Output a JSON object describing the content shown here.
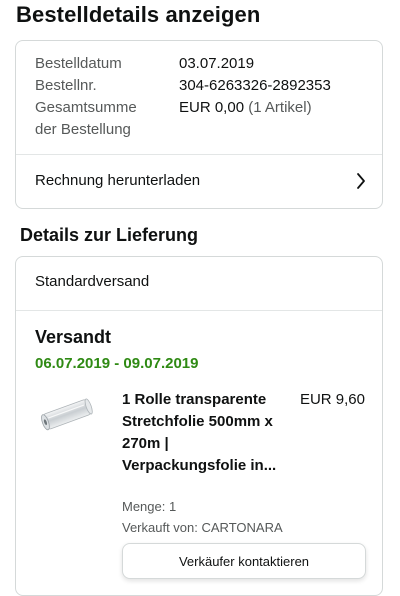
{
  "page": {
    "title": "Bestelldetails anzeigen"
  },
  "order_summary": {
    "date_label": "Bestelldatum",
    "date_value": "03.07.2019",
    "order_no_label": "Bestellnr.",
    "order_no_value": "304-6263326-2892353",
    "total_label_line1": "Gesamtsumme",
    "total_label_line2": "der Bestellung",
    "total_value": "EUR 0,00",
    "total_items": "(1 Artikel)",
    "invoice_label": "Rechnung herunterladen"
  },
  "delivery": {
    "section_title": "Details zur Lieferung",
    "shipping_method": "Standardversand",
    "status": "Versandt",
    "dates": "06.07.2019 - 09.07.2019",
    "item": {
      "title": "1 Rolle transparente Stretchfolie 500mm x 270m | Verpackungsfolie in...",
      "price": "EUR 9,60",
      "quantity": "Menge: 1",
      "seller": "Verkauft von: CARTONARA",
      "image_icon": "stretch-film-roll"
    },
    "contact_seller_label": "Verkäufer kontaktieren"
  },
  "colors": {
    "delivery_date_green": "#2f8a14",
    "border": "#d5d9d9",
    "muted_text": "#565959"
  }
}
